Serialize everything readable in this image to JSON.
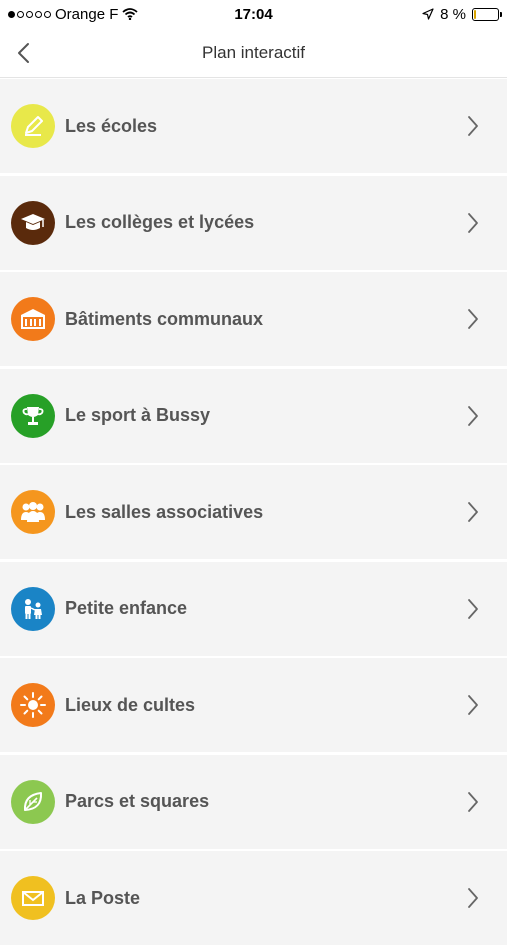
{
  "status_bar": {
    "carrier": "Orange F",
    "time": "17:04",
    "battery_percent": "8 %",
    "battery_level": 0.08,
    "signal_dots_filled": 1,
    "signal_dots_total": 5
  },
  "nav": {
    "title": "Plan interactif",
    "back_icon": "chevron-left-icon"
  },
  "items": [
    {
      "label": "Les écoles",
      "icon": "pencil-icon",
      "color": "#e8e84a"
    },
    {
      "label": "Les collèges et lycées",
      "icon": "graduation-cap-icon",
      "color": "#5a2a0c"
    },
    {
      "label": "Bâtiments communaux",
      "icon": "building-icon",
      "color": "#f27a1a"
    },
    {
      "label": "Le sport à Bussy",
      "icon": "trophy-icon",
      "color": "#27a027"
    },
    {
      "label": "Les salles associatives",
      "icon": "people-group-icon",
      "color": "#f5961e"
    },
    {
      "label": "Petite enfance",
      "icon": "family-icon",
      "color": "#1a84c6"
    },
    {
      "label": "Lieux de cultes",
      "icon": "sun-icon",
      "color": "#f27a1a"
    },
    {
      "label": "Parcs et squares",
      "icon": "leaf-icon",
      "color": "#8cc850"
    },
    {
      "label": "La Poste",
      "icon": "envelope-icon",
      "color": "#f0c020"
    }
  ]
}
